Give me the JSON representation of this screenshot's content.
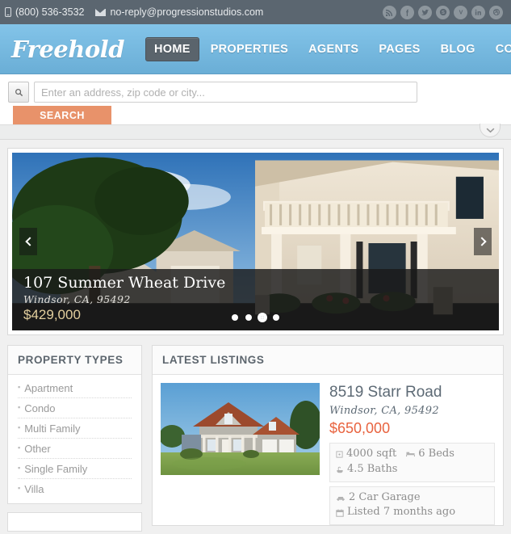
{
  "topbar": {
    "phone": "(800) 536-3532",
    "email": "no-reply@progressionstudios.com",
    "phone_icon": "mobile-phone-icon",
    "email_icon": "envelope-icon",
    "social": [
      {
        "name": "rss",
        "label": "RSS"
      },
      {
        "name": "facebook",
        "label": "f"
      },
      {
        "name": "twitter",
        "label": "t"
      },
      {
        "name": "skype",
        "label": "S"
      },
      {
        "name": "vimeo",
        "label": "V"
      },
      {
        "name": "linkedin",
        "label": "in"
      },
      {
        "name": "dribbble",
        "label": "d"
      }
    ],
    "bg_color": "#5b6670"
  },
  "header": {
    "logo": "Freehold",
    "accent_color": "#6aaed6",
    "nav": [
      {
        "label": "HOME",
        "active": true
      },
      {
        "label": "PROPERTIES",
        "active": false
      },
      {
        "label": "AGENTS",
        "active": false
      },
      {
        "label": "PAGES",
        "active": false
      },
      {
        "label": "BLOG",
        "active": false
      },
      {
        "label": "CONTACT",
        "active": false
      }
    ]
  },
  "search": {
    "icon": "search-icon",
    "placeholder": "Enter an address, zip code or city...",
    "value": "",
    "button_label": "SEARCH",
    "button_color": "#e8926a",
    "toggle_icon": "chevron-down-icon"
  },
  "slider": {
    "prev_icon": "chevron-left-icon",
    "next_icon": "chevron-right-icon",
    "caption": {
      "title": "107 Summer Wheat Drive",
      "location": "Windsor, CA, 95492",
      "price": "$429,000",
      "price_color": "#e3cf9e"
    },
    "dots": [
      {
        "active": false
      },
      {
        "active": false
      },
      {
        "active": true
      },
      {
        "active": false
      }
    ]
  },
  "property_types": {
    "title": "PROPERTY TYPES",
    "items": [
      {
        "label": "Apartment"
      },
      {
        "label": "Condo"
      },
      {
        "label": "Multi Family"
      },
      {
        "label": "Other"
      },
      {
        "label": "Single Family"
      },
      {
        "label": "Villa"
      }
    ]
  },
  "latest_listings": {
    "title": "LATEST LISTINGS",
    "items": [
      {
        "title": "8519 Starr Road",
        "location": "Windsor, CA, 95492",
        "price": "$650,000",
        "price_color": "#e8633f",
        "stats_primary": [
          {
            "icon": "area-icon",
            "label": "4000 sqft"
          },
          {
            "icon": "bed-icon",
            "label": "6 Beds"
          }
        ],
        "stats_primary_second": [
          {
            "icon": "bath-icon",
            "label": "4.5 Baths"
          }
        ],
        "stats_secondary": [
          {
            "icon": "car-icon",
            "label": "2 Car Garage"
          },
          {
            "icon": "calendar-icon",
            "label": "Listed 7 months ago"
          }
        ]
      }
    ]
  }
}
